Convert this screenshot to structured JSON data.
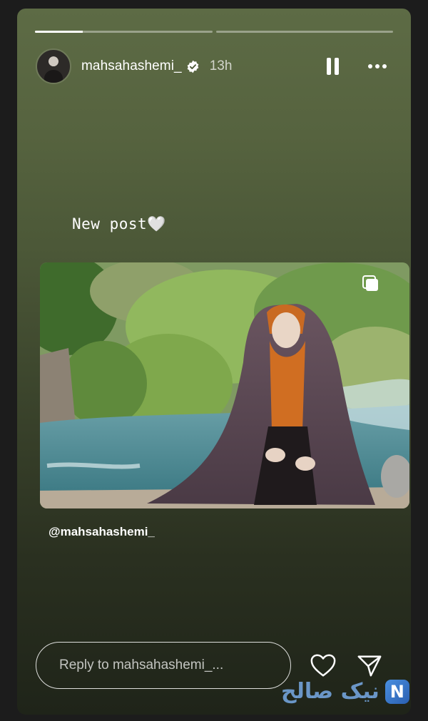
{
  "story": {
    "progress": [
      {
        "fill_fraction": 0.27
      },
      {
        "fill_fraction": 0
      }
    ],
    "username": "mahsahashemi_",
    "verified": true,
    "time": "13h",
    "caption": "New post🤍",
    "mention": "@mahsahashemi_",
    "shared_post_image": "woman-in-orange-hijab-and-chador-by-river",
    "multi_image_icon": "carousel-icon"
  },
  "footer": {
    "reply_placeholder": "Reply to mahsahashemi_...",
    "like_icon": "heart-icon",
    "share_icon": "send-icon"
  },
  "watermark": {
    "text": "نیک صالح",
    "logo_letter": "N"
  },
  "colors": {
    "background_top": "#5d6b45",
    "background_bottom": "#1f2419",
    "text": "#ffffff",
    "verified_badge": "#ffffff"
  }
}
